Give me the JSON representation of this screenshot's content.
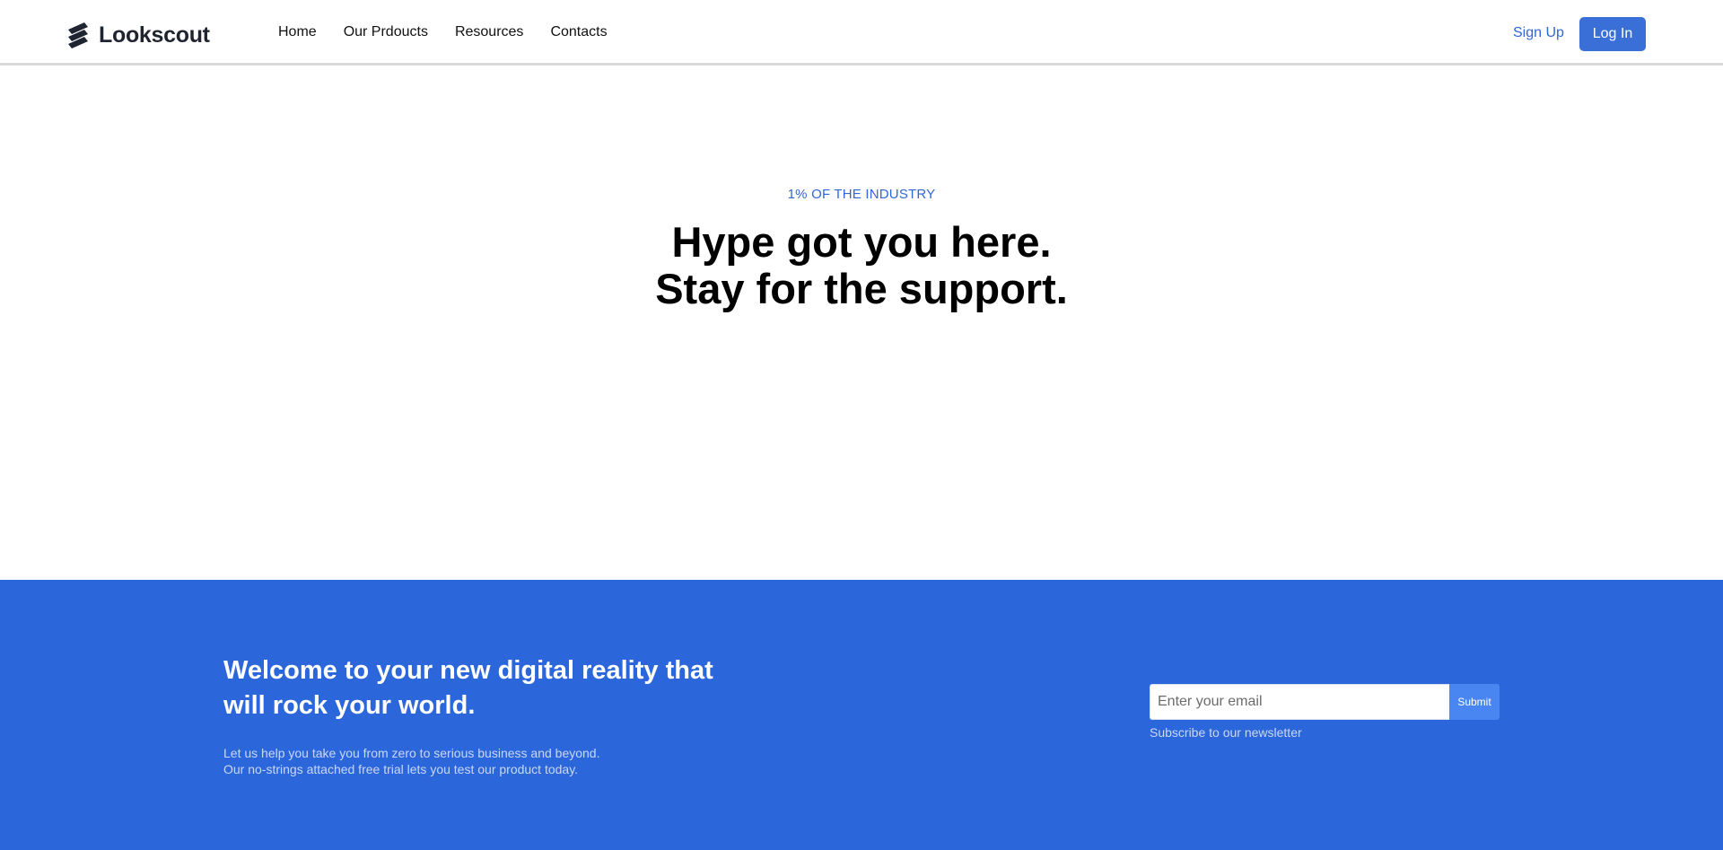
{
  "header": {
    "logo_text": "Lookscout",
    "nav": [
      {
        "label": "Home"
      },
      {
        "label": "Our Prdoucts"
      },
      {
        "label": "Resources"
      },
      {
        "label": "Contacts"
      }
    ],
    "signup_label": "Sign Up",
    "login_label": "Log In"
  },
  "hero": {
    "eyebrow": "1% OF THE INDUSTRY",
    "headline_line1": "Hype got you here.",
    "headline_line2": "Stay for the support."
  },
  "band": {
    "title_line1": "Welcome to your new digital reality that",
    "title_line2": "will rock your world.",
    "text_line1": "Let us help you take you from zero to serious business and beyond.",
    "text_line2": "Our no-strings attached free trial lets you test our product today.",
    "email_placeholder": "Enter your email",
    "submit_label": "Submit",
    "subscribe_note": "Subscribe to our newsletter"
  },
  "colors": {
    "accent": "#3067d6",
    "band_background": "#2c66db",
    "login_background": "#3a6fd8",
    "submit_background": "#4a86f2"
  },
  "icons": {
    "logo": "logo-stripes-icon"
  }
}
